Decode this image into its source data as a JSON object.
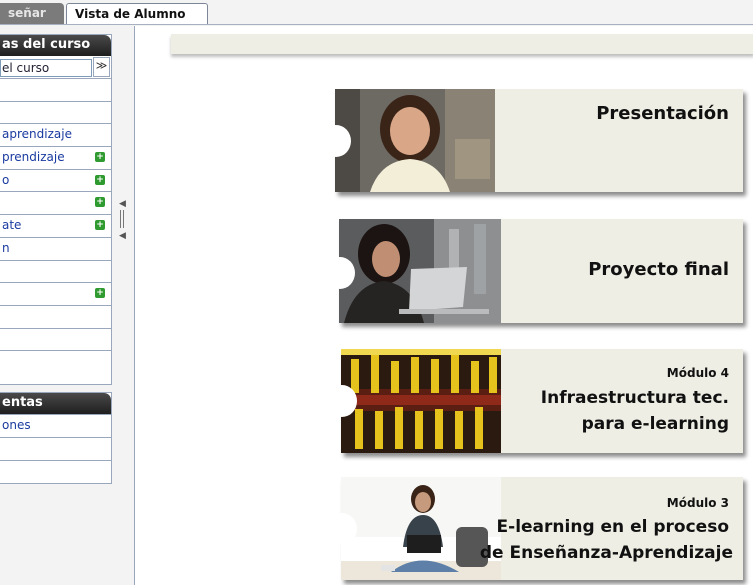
{
  "tabs": {
    "teach": "señar",
    "student": "Vista de Alumno"
  },
  "course_panel": {
    "title": "as del curso",
    "select_value": "el curso",
    "select_button": "≫",
    "items": [
      {
        "label": "",
        "plus": false
      },
      {
        "label": "",
        "plus": false
      },
      {
        "label": " aprendizaje",
        "plus": false
      },
      {
        "label": "prendizaje",
        "plus": true
      },
      {
        "label": "o",
        "plus": true
      },
      {
        "label": "",
        "plus": true
      },
      {
        "label": "ate",
        "plus": true
      },
      {
        "label": "n",
        "plus": false
      },
      {
        "label": "",
        "plus": false
      },
      {
        "label": "",
        "plus": true
      },
      {
        "label": "",
        "plus": false
      },
      {
        "label": "",
        "plus": false
      },
      {
        "label": "",
        "plus": false
      }
    ]
  },
  "tools_panel": {
    "title": "entas",
    "items": [
      "ones",
      "",
      ""
    ]
  },
  "cards": {
    "presentacion": {
      "title": "Presentación"
    },
    "proyecto": {
      "title": "Proyecto final"
    },
    "modulo4": {
      "module": "Módulo 4",
      "line1": "Infraestructura tec.",
      "line2": "para e-learning"
    },
    "modulo3": {
      "module": "Módulo 3",
      "line1": "E-learning en el proceso",
      "line2": "de Enseñanza-Aprendizaje"
    }
  },
  "colors": {
    "card_bg": "#efeee5",
    "panel_header": "#2a2a2a",
    "link": "#1a3aa0",
    "plus_badge": "#2f9a2f"
  },
  "icons": {
    "plus": "plus-square-icon",
    "collapse": "collapse-arrows-icon"
  }
}
